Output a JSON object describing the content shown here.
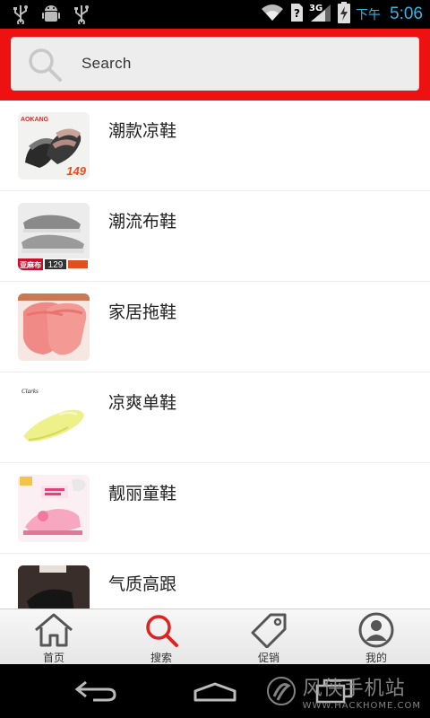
{
  "status_bar": {
    "time": "5:06",
    "ampm": "下午",
    "network": "3G",
    "icons": [
      "usb-icon",
      "android-debug-icon",
      "usb-icon",
      "wifi-icon",
      "sim-unknown-icon",
      "signal-icon",
      "battery-charging-icon"
    ]
  },
  "search": {
    "placeholder_label": "Search",
    "icon": "search-icon"
  },
  "categories": [
    {
      "label": "潮款凉鞋",
      "thumb_text": "149",
      "brand": "AOKANG"
    },
    {
      "label": "潮流布鞋",
      "thumb_text": "129",
      "brand": "亚麻布"
    },
    {
      "label": "家居拖鞋"
    },
    {
      "label": "凉爽单鞋",
      "brand": "Clarks"
    },
    {
      "label": "靓丽童鞋"
    },
    {
      "label": "气质高跟"
    }
  ],
  "bottom_nav": {
    "tabs": [
      {
        "label": "首页",
        "icon": "home-icon"
      },
      {
        "label": "搜索",
        "icon": "search-icon",
        "active": true
      },
      {
        "label": "促销",
        "icon": "tag-icon"
      },
      {
        "label": "我的",
        "icon": "user-icon"
      }
    ]
  },
  "system_nav": {
    "buttons": [
      "back-icon",
      "home-icon",
      "recents-icon"
    ]
  },
  "watermark": {
    "cn": "风侠手机站",
    "en": "WWW.HACKHOME.COM"
  },
  "colors": {
    "header_red": "#ee1111",
    "accent_red": "#dd2222",
    "status_blue": "#33b5e5"
  }
}
